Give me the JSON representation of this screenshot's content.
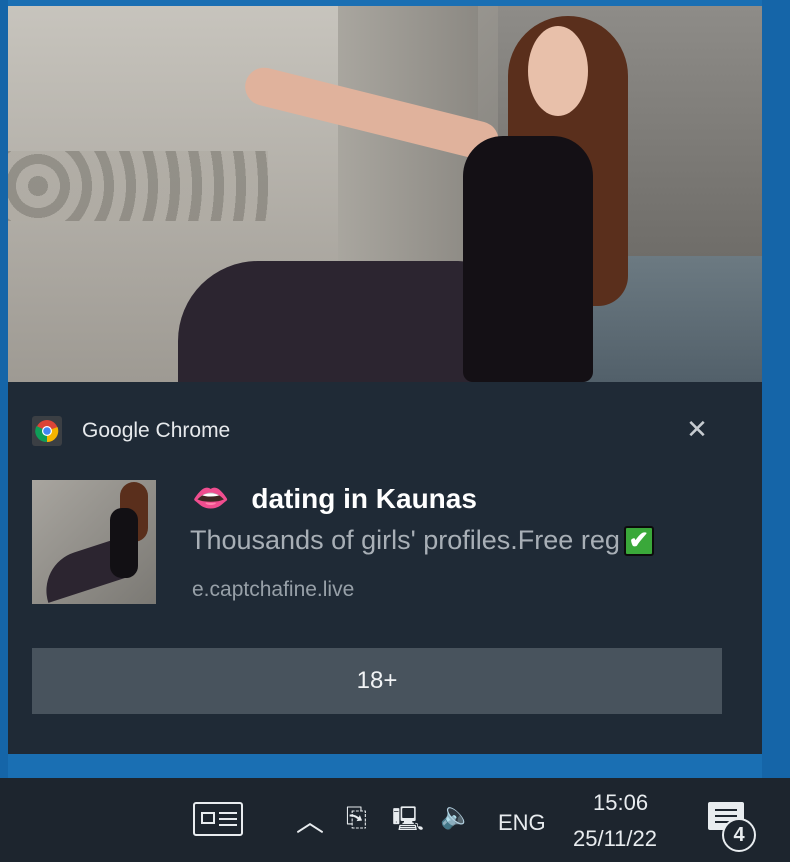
{
  "notification": {
    "app_name": "Google Chrome",
    "close_glyph": "✕",
    "title_emoji": "👄",
    "title": "dating in Kaunas",
    "body": "Thousands of girls' profiles.Free reg",
    "body_emoji": "✔",
    "source": "e.captchafine.live",
    "action_label": "18+"
  },
  "taskbar": {
    "chevron": "︿",
    "meet_icon": "⎘",
    "network_icon": "🖳",
    "volume_icon": "🔈",
    "language": "ENG",
    "time": "15:06",
    "date": "25/11/22",
    "notification_count": "4"
  },
  "colors": {
    "desktop": "#1a6fb3",
    "toast_bg": "#1f2a36",
    "action_bg": "#48535d",
    "taskbar_bg": "#1d252e"
  }
}
